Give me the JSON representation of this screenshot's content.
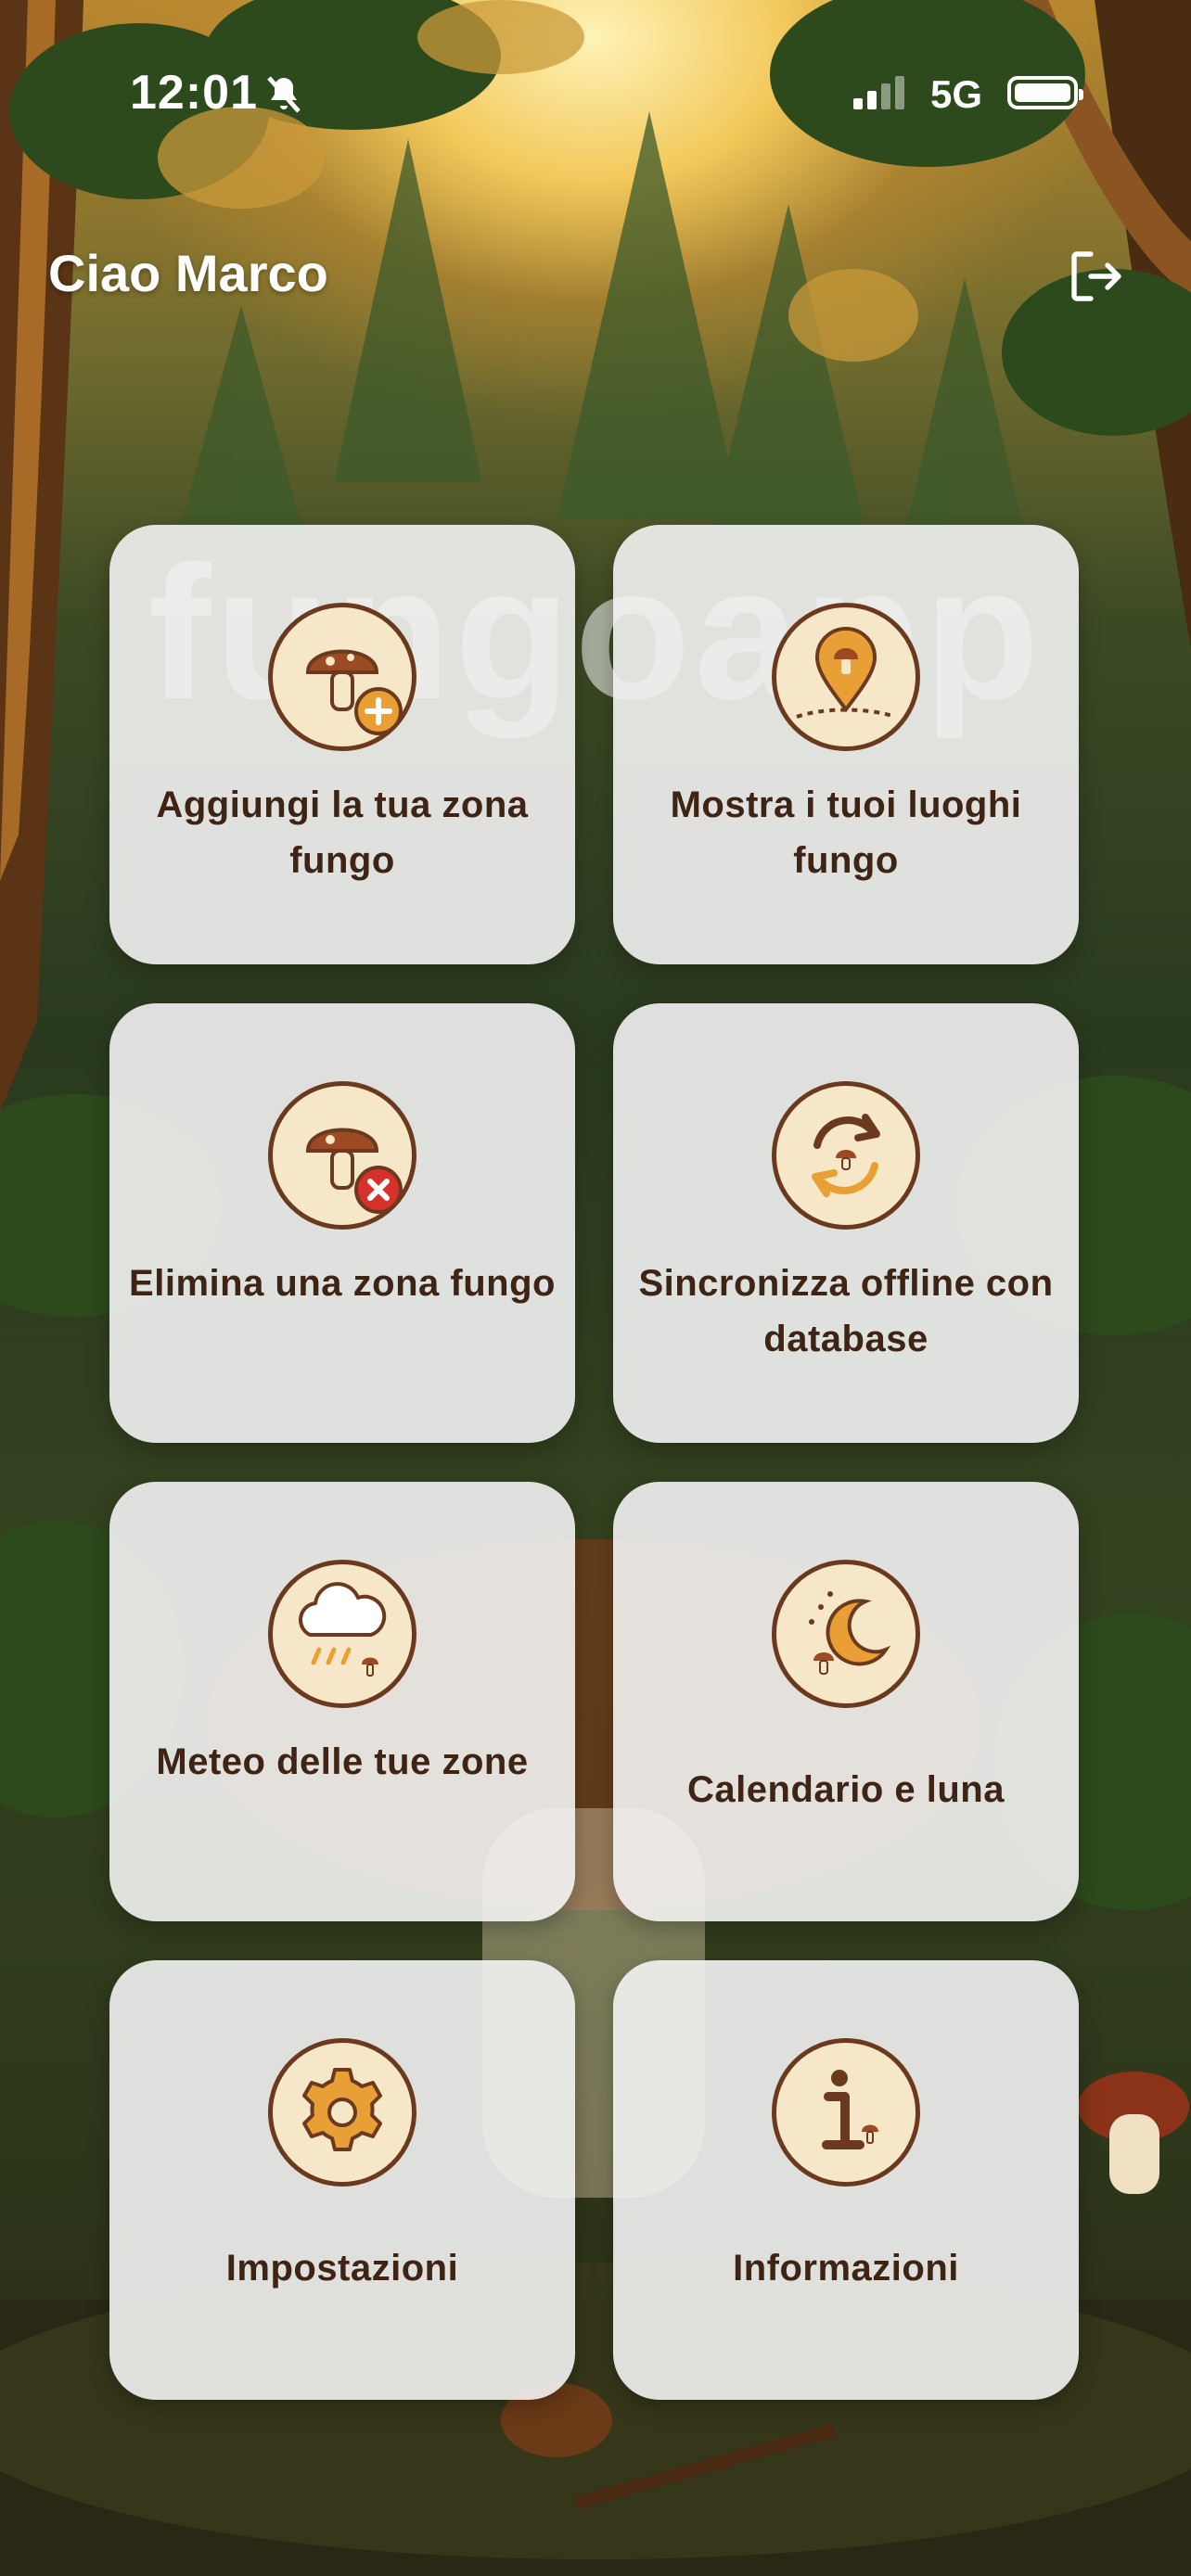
{
  "status_bar": {
    "time": "12:01",
    "network": "5G"
  },
  "header": {
    "greeting": "Ciao Marco"
  },
  "brand": {
    "watermark": "fungoapp"
  },
  "tiles": [
    {
      "label": "Aggiungi la tua zona fungo",
      "icon": "add-mushroom-zone-icon"
    },
    {
      "label": "Mostra i tuoi luoghi fungo",
      "icon": "map-pin-mushroom-icon"
    },
    {
      "label": "Elimina una zona fungo",
      "icon": "delete-mushroom-zone-icon"
    },
    {
      "label": "Sincronizza offline con database",
      "icon": "sync-icon"
    },
    {
      "label": "Meteo delle tue zone",
      "icon": "weather-rain-icon"
    },
    {
      "label": "Calendario e luna",
      "icon": "moon-calendar-icon"
    },
    {
      "label": "Impostazioni",
      "icon": "gear-icon"
    },
    {
      "label": "Informazioni",
      "icon": "info-icon"
    }
  ],
  "colors": {
    "icon_brown": "#6b3a1e",
    "icon_orange": "#e8a036",
    "icon_bg": "#f6e7c8",
    "delete_red": "#d8312b"
  }
}
